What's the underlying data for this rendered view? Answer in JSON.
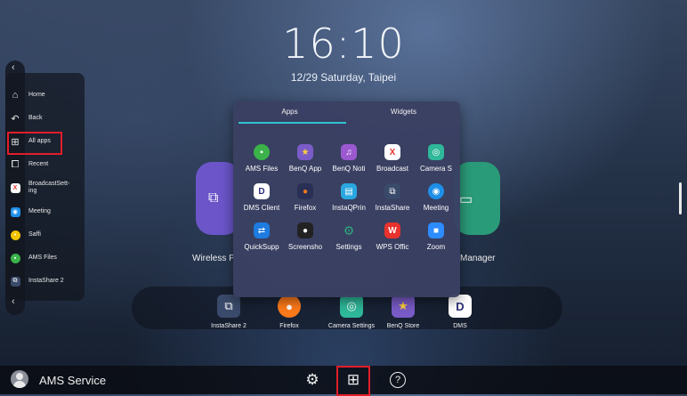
{
  "clock": {
    "time": "16:10",
    "date": "12/29  Saturday, Taipei"
  },
  "sidebar": {
    "items": [
      {
        "label": "Home",
        "icon": "home-icon"
      },
      {
        "label": "Back",
        "icon": "back-icon"
      },
      {
        "label": "All apps",
        "icon": "grid-icon"
      },
      {
        "label": "Recent",
        "icon": "recent-icon"
      },
      {
        "label": "BroadcastSett-\ning",
        "icon": "broadcast-settings-icon"
      },
      {
        "label": "Meeting",
        "icon": "meeting-icon"
      },
      {
        "label": "Saffi",
        "icon": "saffi-icon"
      },
      {
        "label": "AMS Files",
        "icon": "ams-files-icon"
      },
      {
        "label": "InstaShare 2",
        "icon": "instashare-icon"
      }
    ]
  },
  "background_tiles": {
    "left_label": "Wireless P",
    "right_label": "Manager"
  },
  "dock": {
    "items": [
      {
        "label": "InstaShare 2",
        "icon": "instashare-icon",
        "color": "#3a4a6a"
      },
      {
        "label": "Firefox",
        "icon": "firefox-icon",
        "color": "#ff7a1a"
      },
      {
        "label": "Camera Settings",
        "icon": "camera-icon",
        "color": "#2fb89a"
      },
      {
        "label": "BenQ Store",
        "icon": "store-icon",
        "color": "#7a5cc8"
      },
      {
        "label": "DMS",
        "icon": "dms-icon",
        "color": "#ffffff"
      }
    ]
  },
  "apps_popup": {
    "tabs": [
      "Apps",
      "Widgets"
    ],
    "active_tab": "Apps",
    "apps": [
      {
        "label": "AMS Files",
        "icon": "ams-files-icon",
        "color": "#3bb34a"
      },
      {
        "label": "BenQ App",
        "icon": "benq-app-store-icon",
        "color": "#7a5cc8"
      },
      {
        "label": "BenQ Noti",
        "icon": "benq-notification-icon",
        "color": "#9b59d0"
      },
      {
        "label": "Broadcast",
        "icon": "broadcast-icon",
        "color": "#ffffff"
      },
      {
        "label": "Camera S",
        "icon": "camera-settings-icon",
        "color": "#2fb89a"
      },
      {
        "label": "DMS Client",
        "icon": "dms-client-icon",
        "color": "#ffffff"
      },
      {
        "label": "Firefox",
        "icon": "firefox-icon",
        "color": "#ff7a1a"
      },
      {
        "label": "InstaQPrin",
        "icon": "instaqprint-icon",
        "color": "#2aa7e0"
      },
      {
        "label": "InstaShare",
        "icon": "instashare-icon",
        "color": "#3a4a6a"
      },
      {
        "label": "Meeting",
        "icon": "meeting-icon",
        "color": "#1e8fe8"
      },
      {
        "label": "QuickSupp",
        "icon": "quicksupport-icon",
        "color": "#1e7be0"
      },
      {
        "label": "Screensho",
        "icon": "screenshot-icon",
        "color": "#222222"
      },
      {
        "label": "Settings",
        "icon": "settings-gear-icon",
        "color": "#2fa87a"
      },
      {
        "label": "WPS Offic",
        "icon": "wps-office-icon",
        "color": "#e8322d"
      },
      {
        "label": "Zoom",
        "icon": "zoom-icon",
        "color": "#2d8cff"
      }
    ]
  },
  "taskbar": {
    "user_name": "AMS Service"
  }
}
